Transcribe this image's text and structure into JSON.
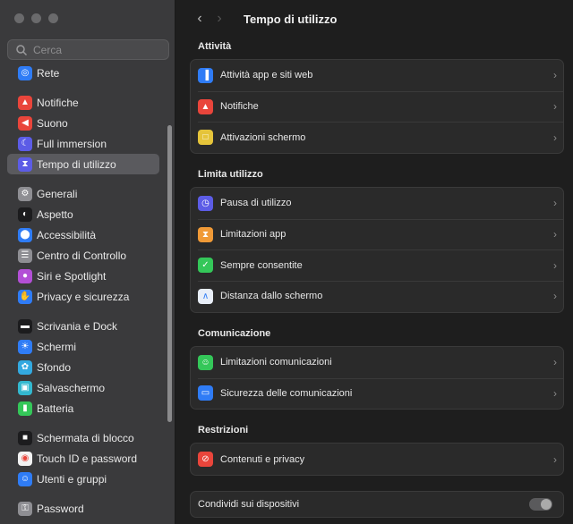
{
  "search": {
    "placeholder": "Cerca"
  },
  "sidebar": {
    "groups": [
      [
        {
          "label": "Rete",
          "icon": "globe-icon",
          "color": "#2f7cf6"
        }
      ],
      [
        {
          "label": "Notifiche",
          "icon": "bell-icon",
          "color": "#e9453b"
        },
        {
          "label": "Suono",
          "icon": "speaker-icon",
          "color": "#e9453b"
        },
        {
          "label": "Full immersion",
          "icon": "moon-icon",
          "color": "#5c5ce6"
        },
        {
          "label": "Tempo di utilizzo",
          "icon": "hourglass-icon",
          "color": "#5c5ce6",
          "active": true
        }
      ],
      [
        {
          "label": "Generali",
          "icon": "gear-icon",
          "color": "#8e8e93"
        },
        {
          "label": "Aspetto",
          "icon": "appearance-icon",
          "color": "#1c1c1e"
        },
        {
          "label": "Accessibilità",
          "icon": "accessibility-icon",
          "color": "#2f7cf6"
        },
        {
          "label": "Centro di Controllo",
          "icon": "control-center-icon",
          "color": "#8e8e93"
        },
        {
          "label": "Siri e Spotlight",
          "icon": "siri-icon",
          "color": "#b34fd6"
        },
        {
          "label": "Privacy e sicurezza",
          "icon": "hand-icon",
          "color": "#2f7cf6"
        }
      ],
      [
        {
          "label": "Scrivania e Dock",
          "icon": "dock-icon",
          "color": "#1c1c1e"
        },
        {
          "label": "Schermi",
          "icon": "sun-icon",
          "color": "#2f7cf6"
        },
        {
          "label": "Sfondo",
          "icon": "wallpaper-icon",
          "color": "#33a9e0"
        },
        {
          "label": "Salvaschermo",
          "icon": "screensaver-icon",
          "color": "#33b8cf"
        },
        {
          "label": "Batteria",
          "icon": "battery-icon",
          "color": "#34c759"
        }
      ],
      [
        {
          "label": "Schermata di blocco",
          "icon": "lock-icon",
          "color": "#1c1c1e"
        },
        {
          "label": "Touch ID e password",
          "icon": "fingerprint-icon",
          "color": "#f2f2f2"
        },
        {
          "label": "Utenti e gruppi",
          "icon": "users-icon",
          "color": "#2f7cf6"
        }
      ],
      [
        {
          "label": "Password",
          "icon": "key-icon",
          "color": "#8e8e93"
        }
      ]
    ]
  },
  "header": {
    "title": "Tempo di utilizzo"
  },
  "sections": [
    {
      "title": "Attività",
      "rows": [
        {
          "label": "Attività app e siti web",
          "icon": "chart-icon",
          "color": "#2f7cf6"
        },
        {
          "label": "Notifiche",
          "icon": "bell-icon",
          "color": "#e9453b"
        },
        {
          "label": "Attivazioni schermo",
          "icon": "pickup-icon",
          "color": "#e5c43a"
        }
      ]
    },
    {
      "title": "Limita utilizzo",
      "rows": [
        {
          "label": "Pausa di utilizzo",
          "icon": "downtime-icon",
          "color": "#5c5ce6"
        },
        {
          "label": "Limitazioni app",
          "icon": "hourglass-icon",
          "color": "#f09a37"
        },
        {
          "label": "Sempre consentite",
          "icon": "checkmark-icon",
          "color": "#34c759"
        },
        {
          "label": "Distanza dallo schermo",
          "icon": "distance-icon",
          "color": "#e8eef8"
        }
      ]
    },
    {
      "title": "Comunicazione",
      "rows": [
        {
          "label": "Limitazioni comunicazioni",
          "icon": "contact-icon",
          "color": "#34c759"
        },
        {
          "label": "Sicurezza delle comunicazioni",
          "icon": "chat-icon",
          "color": "#2f7cf6"
        }
      ]
    },
    {
      "title": "Restrizioni",
      "rows": [
        {
          "label": "Contenuti e privacy",
          "icon": "restricted-icon",
          "color": "#e9453b"
        }
      ]
    }
  ],
  "share": {
    "label": "Condividi sui dispositivi",
    "enabled": false
  }
}
